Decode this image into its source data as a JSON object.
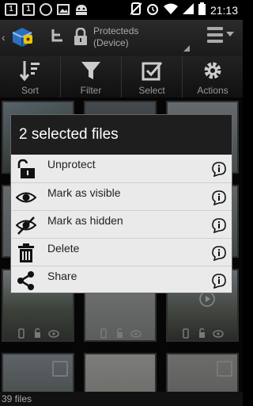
{
  "status_bar": {
    "time": "21:13",
    "left_icons": [
      "calendar-icon",
      "calendar-icon",
      "whatsapp-icon",
      "image-icon",
      "android-icon"
    ],
    "right_icons": [
      "phone-off-icon",
      "alarm-icon",
      "wifi-icon",
      "signal-icon",
      "battery-icon"
    ],
    "calendar_day_1": "1",
    "calendar_day_2": "1"
  },
  "action_bar": {
    "title_line1": "Protecteds",
    "title_line2": "(Device)"
  },
  "toolbar": {
    "items": [
      {
        "label": "Sort",
        "icon": "sort-icon"
      },
      {
        "label": "Filter",
        "icon": "filter-icon"
      },
      {
        "label": "Select",
        "icon": "select-checkbox-icon"
      },
      {
        "label": "Actions",
        "icon": "gear-icon"
      }
    ]
  },
  "dialog": {
    "title": "2 selected files",
    "items": [
      {
        "label": "Unprotect",
        "icon": "unlock-icon"
      },
      {
        "label": "Mark as visible",
        "icon": "eye-icon"
      },
      {
        "label": "Mark as hidden",
        "icon": "eye-off-icon"
      },
      {
        "label": "Delete",
        "icon": "trash-icon"
      },
      {
        "label": "Share",
        "icon": "share-icon"
      }
    ]
  },
  "footer": {
    "file_count": "39 files"
  },
  "colors": {
    "background": "#000000",
    "dialog_bg": "#eaeaea",
    "dialog_header": "#1e1e1e",
    "toolbar_text": "#999999"
  }
}
